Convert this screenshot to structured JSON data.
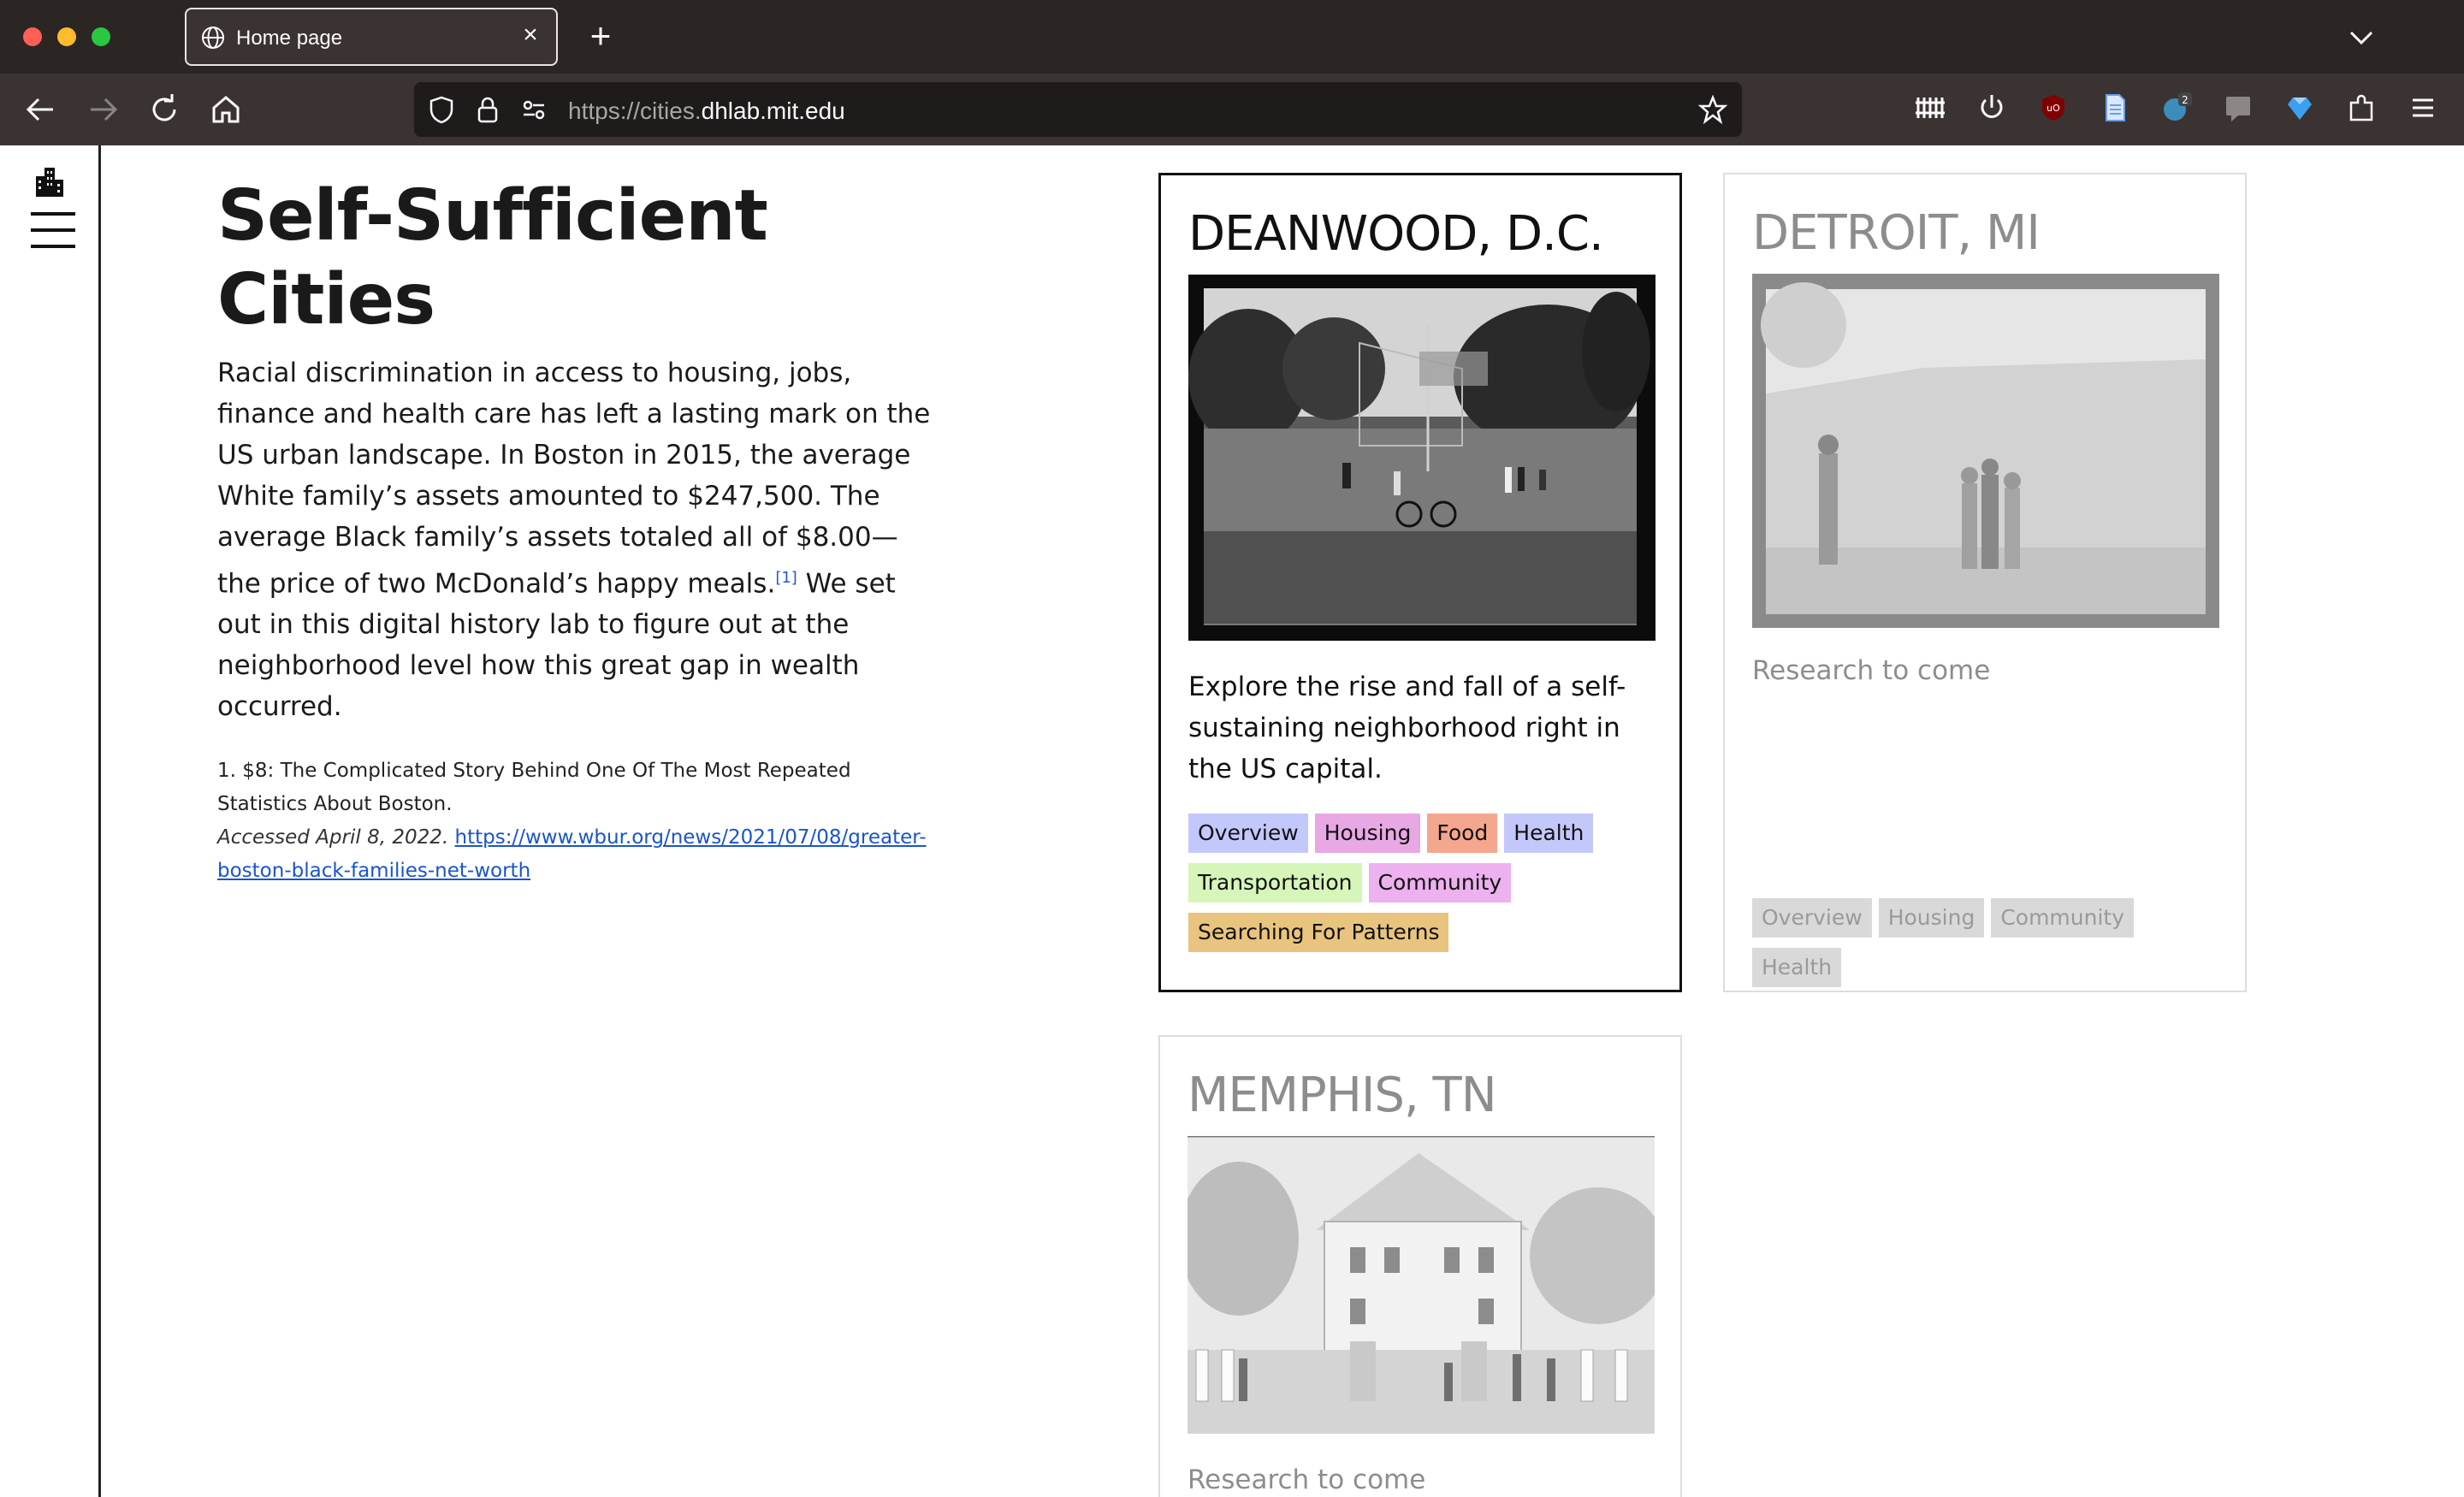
{
  "browser": {
    "tab_title": "Home page",
    "url_prefix": "https://cities.",
    "url_host": "dhlab.mit.edu",
    "extension_badge": "2"
  },
  "intro": {
    "title": "Self-Sufficient Cities",
    "text_before_ref": "Racial discrimination in access to housing, jobs, finance and health care has left a lasting mark on the US urban landscape. In Boston in 2015, the average White family’s assets amounted to $247,500. The average Black family’s assets totaled all of $8.00—the price of two McDonald’s happy meals.",
    "ref_marker": "[1]",
    "text_after_ref": " We set out in this digital history lab to figure out at the neighborhood level how this great gap in wealth occurred.",
    "footnote_title": "1. $8: The Complicated Story Behind One Of The Most Repeated Statistics About Boston.",
    "footnote_accessed": "Accessed April 8, 2022.",
    "footnote_link": "https://www.wbur.org/news/2021/07/08/greater-boston-black-families-net-worth"
  },
  "cards": {
    "deanwood": {
      "title": "DEANWOOD, D.C.",
      "description": "Explore the rise and fall of a self-sustaining neighborhood right in the US capital.",
      "tags": [
        "Overview",
        "Housing",
        "Food",
        "Health",
        "Transportation",
        "Community",
        "Searching For Patterns"
      ],
      "tag_colors": [
        "#c3c8fa",
        "#e8a8e4",
        "#f5a68e",
        "#c3c8fa",
        "#d6f5b8",
        "#ecb1ee",
        "#e8c47e"
      ]
    },
    "detroit": {
      "title": "DETROIT, MI",
      "description": "Research to come",
      "tags": [
        "Overview",
        "Housing",
        "Community",
        "Health"
      ]
    },
    "memphis": {
      "title": "MEMPHIS, TN",
      "description": "Research to come"
    }
  }
}
